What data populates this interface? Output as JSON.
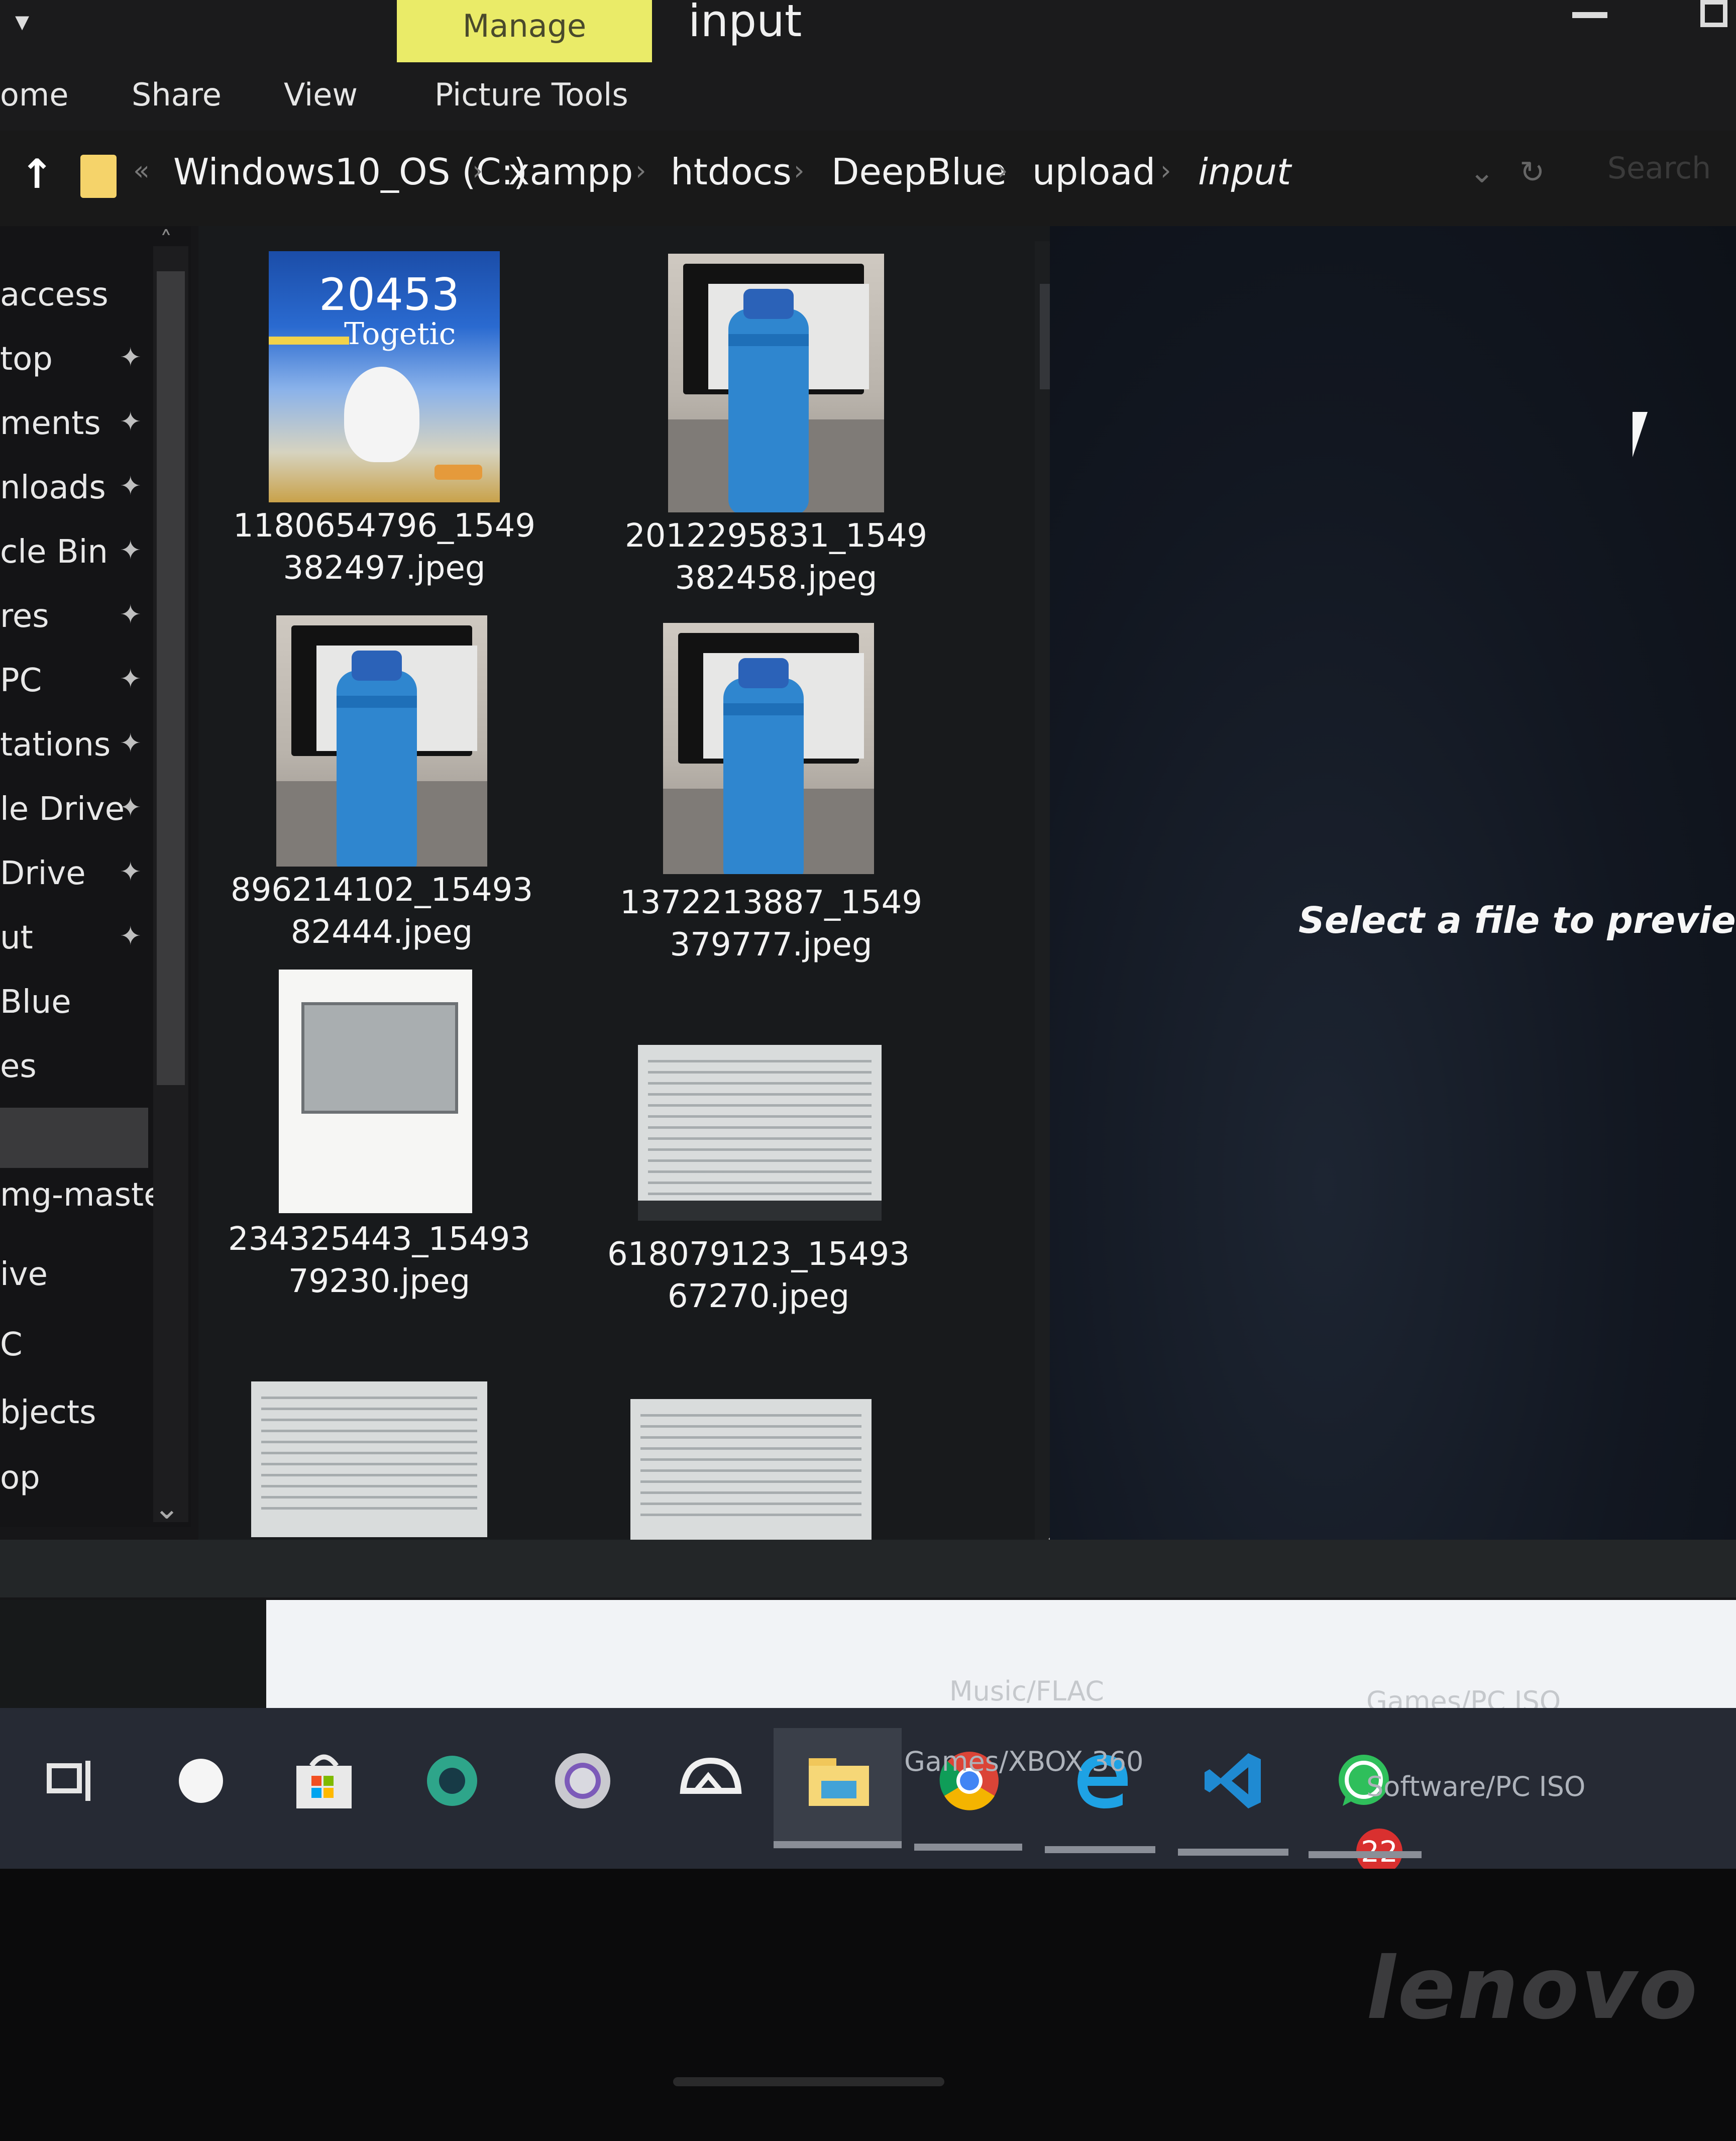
{
  "window": {
    "title": "input",
    "manage_tab": "Manage"
  },
  "ribbon": {
    "tabs": [
      "ome",
      "Share",
      "View",
      "Picture Tools"
    ]
  },
  "address_bar": {
    "crumbs": [
      "Windows10_OS (C:)",
      "xampp",
      "htdocs",
      "DeepBlue",
      "upload",
      "input"
    ],
    "search_placeholder": "Search"
  },
  "nav": {
    "items": [
      {
        "label": "access",
        "pinned": false
      },
      {
        "label": "top",
        "pinned": true
      },
      {
        "label": "ments",
        "pinned": true
      },
      {
        "label": "nloads",
        "pinned": true
      },
      {
        "label": "cle Bin",
        "pinned": true
      },
      {
        "label": "res",
        "pinned": true
      },
      {
        "label": "PC",
        "pinned": true
      },
      {
        "label": "tations",
        "pinned": true
      },
      {
        "label": "le Drive",
        "pinned": true
      },
      {
        "label": "Drive",
        "pinned": true
      },
      {
        "label": "ut",
        "pinned": true
      },
      {
        "label": "Blue",
        "pinned": false
      },
      {
        "label": "es",
        "pinned": false
      },
      {
        "label": "",
        "pinned": false,
        "selected": true
      },
      {
        "label": "mg-master",
        "pinned": false
      },
      {
        "label": "ive",
        "pinned": false
      },
      {
        "label": "C",
        "pinned": false
      },
      {
        "label": "bjects",
        "pinned": false
      },
      {
        "label": "op",
        "pinned": false
      }
    ]
  },
  "files": [
    {
      "line1": "1180654796_1549",
      "line2": "382497.jpeg",
      "art": "pokemon",
      "overlay_num": "20453",
      "overlay_name": "Togetic"
    },
    {
      "line1": "2012295831_1549",
      "line2": "382458.jpeg",
      "art": "bottle"
    },
    {
      "line1": "896214102_15493",
      "line2": "82444.jpeg",
      "art": "bottle"
    },
    {
      "line1": "1372213887_1549",
      "line2": "379777.jpeg",
      "art": "bottle"
    },
    {
      "line1": "234325443_15493",
      "line2": "79230.jpeg",
      "art": "doc"
    },
    {
      "line1": "618079123_15493",
      "line2": "67270.jpeg",
      "art": "screen"
    },
    {
      "line1": "",
      "line2": "",
      "art": "screen"
    },
    {
      "line1": "",
      "line2": "",
      "art": "screen"
    }
  ],
  "preview": {
    "message": "Select a file to preview."
  },
  "background_window": {
    "items": [
      "Music/FLAC",
      "Games/XBOX 360",
      "Games/PC ISO",
      "Software/PC ISO"
    ]
  },
  "taskbar": {
    "icons": [
      "task-view",
      "cortana",
      "store",
      "app-green",
      "app-circle",
      "app-cloud",
      "file-explorer",
      "chrome",
      "edge",
      "vs-code",
      "whatsapp"
    ],
    "whatsapp_badge": "22"
  },
  "bezel": {
    "brand": "lenovo"
  },
  "colors": {
    "manage_tab": "#eaeb68",
    "folder": "#f5d36a",
    "badge": "#d9302f",
    "taskbar": "#262a34"
  }
}
